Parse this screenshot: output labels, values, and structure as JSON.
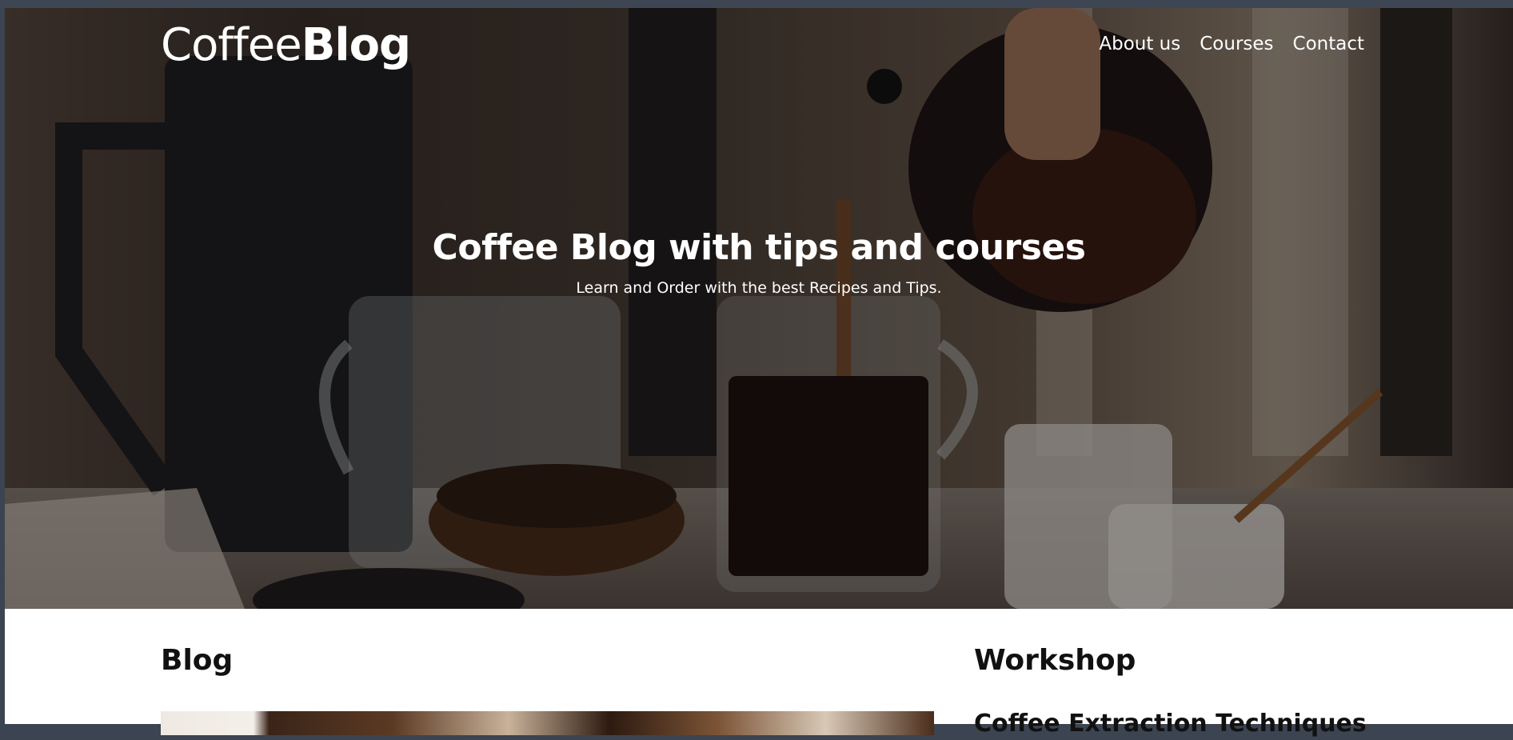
{
  "header": {
    "logo_light": "Coffee",
    "logo_bold": "Blog",
    "nav": [
      {
        "label": "About us"
      },
      {
        "label": "Courses"
      },
      {
        "label": "Contact"
      }
    ]
  },
  "hero": {
    "title": "Coffee Blog with tips and courses",
    "subtitle": "Learn and Order with the best Recipes and Tips."
  },
  "main": {
    "blog_heading": "Blog",
    "workshop_heading": "Workshop",
    "workshop_item_title": "Coffee Extraction Techniques"
  }
}
